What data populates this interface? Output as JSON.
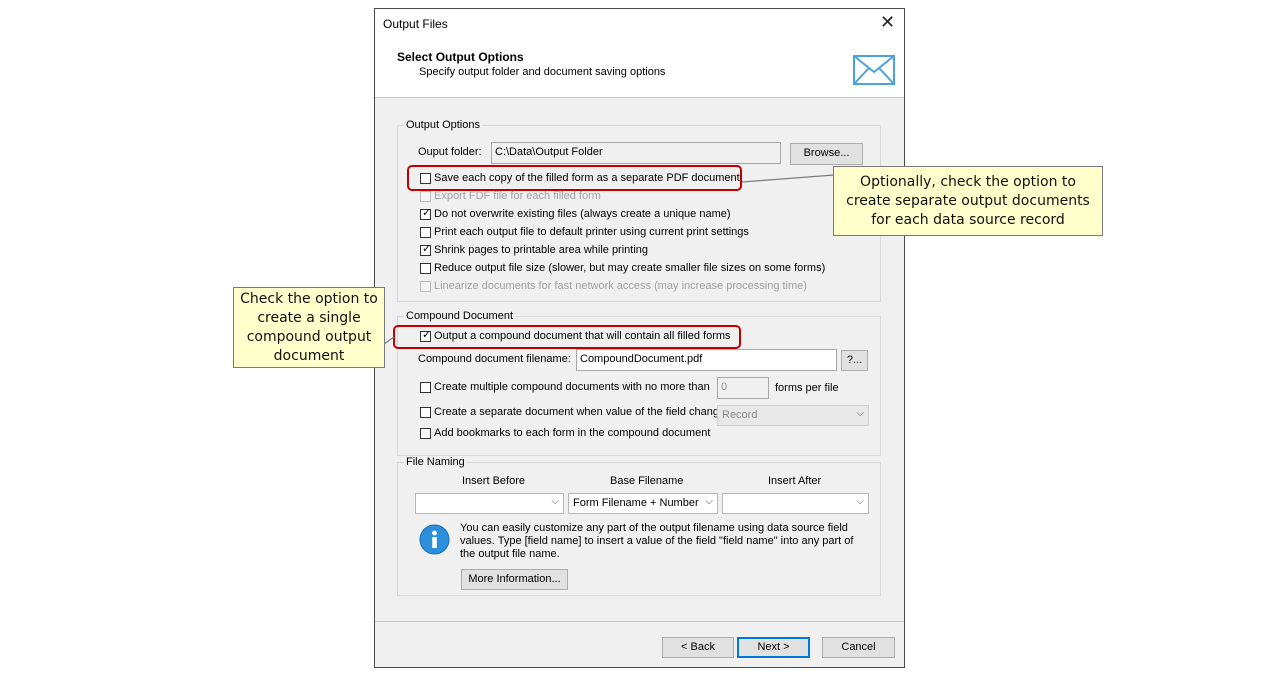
{
  "dialog": {
    "title": "Output Files",
    "header_title": "Select Output Options",
    "header_subtitle": "Specify output folder and document saving options"
  },
  "output_options": {
    "group_label": "Output Options",
    "folder_label": "Ouput folder:",
    "folder_value": "C:\\Data\\Output Folder",
    "browse_label": "Browse...",
    "options": [
      {
        "label": "Save each copy of the filled form as a separate PDF document",
        "checked": false,
        "enabled": true
      },
      {
        "label": "Export FDF file for each filled form",
        "checked": false,
        "enabled": false
      },
      {
        "label": "Do not overwrite existing files (always create a unique name)",
        "checked": true,
        "enabled": true
      },
      {
        "label": "Print each output file to default printer using current print settings",
        "checked": false,
        "enabled": true
      },
      {
        "label": "Shrink pages to printable area while printing",
        "checked": true,
        "enabled": true
      },
      {
        "label": "Reduce output file size  (slower, but may create smaller file sizes on some forms)",
        "checked": false,
        "enabled": true
      },
      {
        "label": "Linearize documents for fast network access (may increase processing time)",
        "checked": false,
        "enabled": false
      }
    ]
  },
  "compound": {
    "group_label": "Compound Document",
    "output_compound_label": "Output a compound document that will contain all filled forms",
    "output_compound_checked": true,
    "filename_label": "Compound document filename:",
    "filename_value": "CompoundDocument.pdf",
    "help_button": "?...",
    "multiple_label": "Create multiple compound documents with no more than",
    "multiple_checked": false,
    "multiple_value": "0",
    "forms_per_file": "forms per file",
    "separate_label": "Create a separate document when value of the field chang",
    "separate_checked": false,
    "separate_value": "Record",
    "bookmarks_label": "Add bookmarks to each form in the compound document",
    "bookmarks_checked": false
  },
  "file_naming": {
    "group_label": "File Naming",
    "insert_before": "Insert Before",
    "base_filename": "Base Filename",
    "insert_after": "Insert After",
    "base_value": "Form Filename + Number",
    "info_text": "You can easily customize any part of the output filename using data source field values. Type [field name] to insert a value of the field \"field name\" into any part of the output file name.",
    "more_info": "More Information..."
  },
  "buttons": {
    "back": "< Back",
    "next": "Next >",
    "cancel": "Cancel"
  },
  "callouts": {
    "right": "Optionally, check the option to create separate output documents for each data source record",
    "left": "Check the option to create a single compound output document"
  },
  "colors": {
    "callout_bg": "#ffffcc",
    "highlight": "#c00000",
    "accent": "#0078d7"
  }
}
